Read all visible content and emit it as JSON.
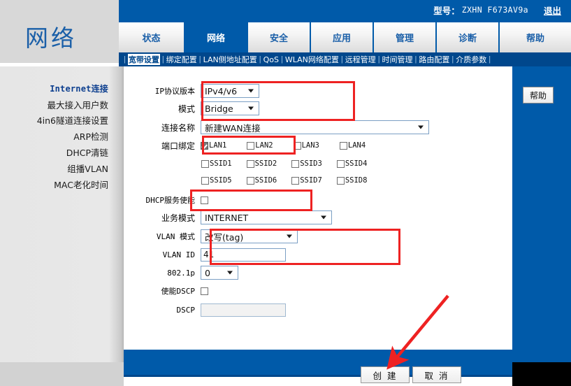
{
  "header": {
    "model_label": "型号：",
    "model_value": "ZXHN F673AV9a",
    "logout_label": "退出",
    "brand_title": "网络"
  },
  "tabs": [
    {
      "label": "状态",
      "active": false
    },
    {
      "label": "网络",
      "active": true
    },
    {
      "label": "安全",
      "active": false
    },
    {
      "label": "应用",
      "active": false
    },
    {
      "label": "管理",
      "active": false
    },
    {
      "label": "诊断",
      "active": false
    },
    {
      "label": "帮助",
      "active": false
    }
  ],
  "subnav": [
    {
      "label": "宽带设置",
      "current": true
    },
    {
      "label": "绑定配置",
      "current": false
    },
    {
      "label": "LAN侧地址配置",
      "current": false
    },
    {
      "label": "QoS",
      "current": false
    },
    {
      "label": "WLAN网络配置",
      "current": false
    },
    {
      "label": "远程管理",
      "current": false
    },
    {
      "label": "时间管理",
      "current": false
    },
    {
      "label": "路由配置",
      "current": false
    },
    {
      "label": "介质参数",
      "current": false
    }
  ],
  "sidebar": {
    "items": [
      {
        "label": "Internet连接",
        "current": true
      },
      {
        "label": "最大接入用户数",
        "current": false
      },
      {
        "label": "4in6隧道连接设置",
        "current": false
      },
      {
        "label": "ARP检测",
        "current": false
      },
      {
        "label": "DHCP清链",
        "current": false
      },
      {
        "label": "组播VLAN",
        "current": false
      },
      {
        "label": "MAC老化时间",
        "current": false
      }
    ]
  },
  "help_button": "帮助",
  "form": {
    "ip_version": {
      "label": "IP协议版本",
      "value": "IPv4/v6"
    },
    "mode": {
      "label": "模式",
      "value": "Bridge"
    },
    "connection_name": {
      "label": "连接名称",
      "value": "新建WAN连接"
    },
    "port_binding": {
      "label": "端口绑定",
      "lan": [
        {
          "label": "LAN1",
          "checked": true
        },
        {
          "label": "LAN2",
          "checked": false
        },
        {
          "label": "LAN3",
          "checked": false
        },
        {
          "label": "LAN4",
          "checked": false
        }
      ],
      "ssid_row1": [
        {
          "label": "SSID1",
          "checked": false
        },
        {
          "label": "SSID2",
          "checked": false
        },
        {
          "label": "SSID3",
          "checked": false
        },
        {
          "label": "SSID4",
          "checked": false
        }
      ],
      "ssid_row2": [
        {
          "label": "SSID5",
          "checked": false
        },
        {
          "label": "SSID6",
          "checked": false
        },
        {
          "label": "SSID7",
          "checked": false
        },
        {
          "label": "SSID8",
          "checked": false
        }
      ]
    },
    "dhcp_enable": {
      "label": "DHCP服务使能",
      "checked": false
    },
    "service_mode": {
      "label": "业务模式",
      "value": "INTERNET"
    },
    "vlan_mode": {
      "label": "VLAN 模式",
      "value": "改写(tag)"
    },
    "vlan_id": {
      "label": "VLAN ID",
      "value": "41"
    },
    "priority_8021p": {
      "label": "802.1p",
      "value": "0"
    },
    "enable_dscp": {
      "label": "使能DSCP",
      "checked": false
    },
    "dscp": {
      "label": "DSCP",
      "value": ""
    }
  },
  "buttons": {
    "create": "创 建",
    "cancel": "取 消"
  },
  "colors": {
    "brand_blue": "#005aa9",
    "dark_blue": "#00478c",
    "annotation_red": "#ee2222",
    "sidebar_gray": "#e6e6e6"
  }
}
